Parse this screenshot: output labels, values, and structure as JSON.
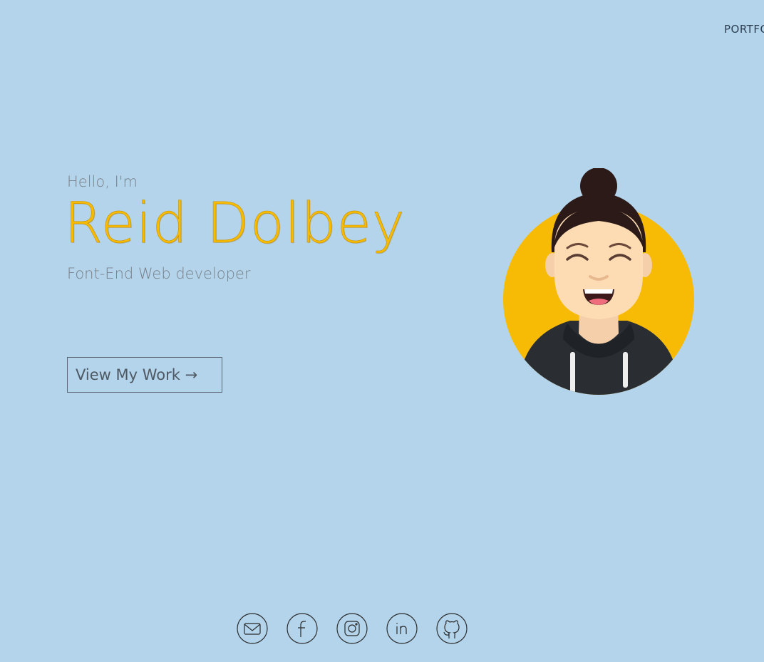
{
  "nav": {
    "portfolio_label": "PORTFOLIO"
  },
  "hero": {
    "greeting": "Hello, I'm",
    "name": "Reid Dolbey",
    "role": "Font-End Web developer",
    "cta_label": "View My Work →"
  },
  "avatar": {
    "icon": "avatar-illustration"
  },
  "socials": [
    {
      "icon": "mail-icon"
    },
    {
      "icon": "facebook-icon"
    },
    {
      "icon": "instagram-icon"
    },
    {
      "icon": "linkedin-icon"
    },
    {
      "icon": "github-icon"
    }
  ],
  "colors": {
    "background": "#b3d4eb",
    "accent": "#f6bc05",
    "text_muted": "#7a8189"
  }
}
